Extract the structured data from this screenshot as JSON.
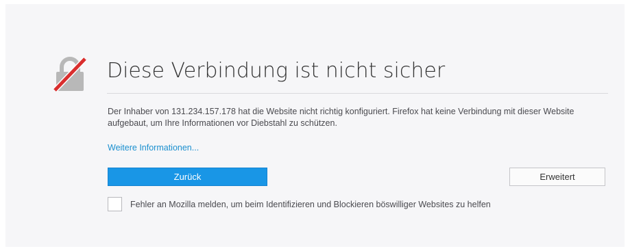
{
  "error_page": {
    "icon": "broken-lock-icon",
    "title": "Diese Verbindung ist nicht sicher",
    "description": "Der Inhaber von 131.234.157.178 hat die Website nicht richtig konfiguriert. Firefox hat keine Verbindung mit dieser Website aufgebaut, um Ihre Informationen vor Diebstahl zu schützen.",
    "learn_more_link": "Weitere Informationen...",
    "back_button": "Zurück",
    "advanced_button": "Erweitert",
    "report_checkbox": {
      "label": "Fehler an Mozilla melden, um beim Identifizieren und Blockieren böswilliger Websites zu helfen",
      "checked": false
    }
  },
  "colors": {
    "accent_blue": "#1996e6",
    "link_blue": "#1a8fcf",
    "warning_red": "#d92e2e",
    "lock_gray": "#b8b8b8",
    "background": "#f6f6f8"
  }
}
